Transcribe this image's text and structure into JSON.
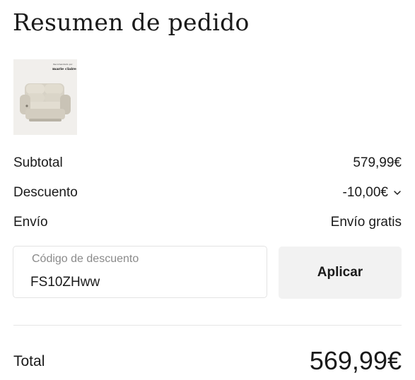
{
  "summary": {
    "title": "Resumen de pedido"
  },
  "product": {
    "image_icon": "armchair-product-image",
    "brand_caption": "Recomendado por",
    "brand_name": "marie claire"
  },
  "totals": {
    "subtotal_label": "Subtotal",
    "subtotal_value": "579,99€",
    "discount_label": "Descuento",
    "discount_value": "-10,00€",
    "discount_toggle_icon": "chevron-down-icon",
    "shipping_label": "Envío",
    "shipping_value": "Envío gratis",
    "total_label": "Total",
    "total_value": "569,99€"
  },
  "discount_code": {
    "label": "Código de descuento",
    "value": "FS10ZHww",
    "apply_label": "Aplicar"
  },
  "colors": {
    "text": "#1a1a1a",
    "muted": "#8a8a8a",
    "button_bg": "#f2f2f2",
    "border": "#e3e3e3"
  }
}
